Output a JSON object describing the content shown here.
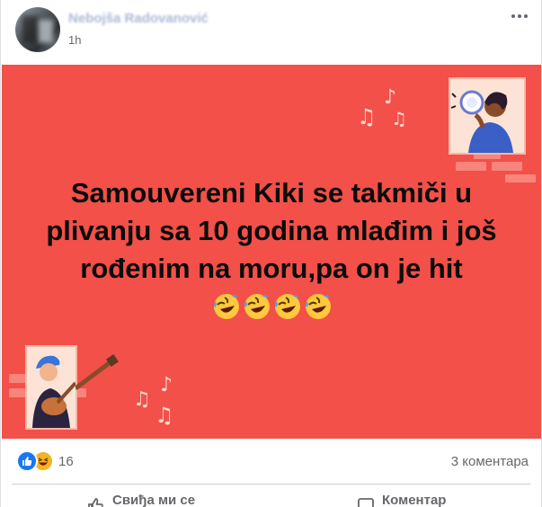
{
  "post": {
    "author": "Nebojša Radovanović",
    "time": "1h",
    "text_main": "Samouvereni Kiki se takmiči u plivanju sa 10 godina mlađim i još rođenim na moru,pa on je hit",
    "emoji": [
      "rofl",
      "rofl",
      "rofl",
      "rofl"
    ],
    "card_color": "#f25048",
    "more_icon": "more-dots-icon"
  },
  "footer": {
    "reaction_icons": [
      "like-icon",
      "haha-icon"
    ],
    "reaction_count": "16",
    "comment_count": "3 коментара",
    "like_label": "Свиђа ми се",
    "comment_label": "Коментар"
  },
  "colors": {
    "accent": "#1877f2",
    "muted_text": "#65676b",
    "haha": "#f7b125"
  }
}
